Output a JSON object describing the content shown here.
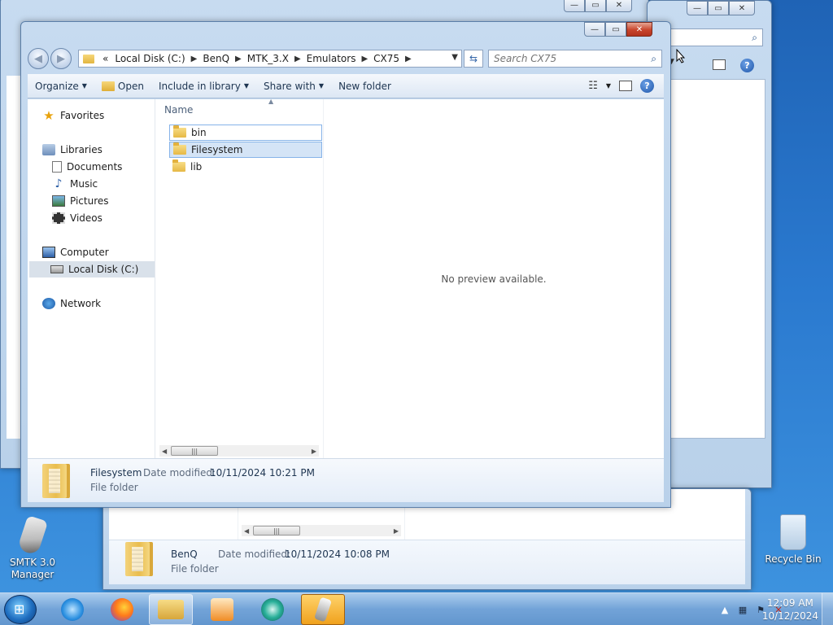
{
  "main_window": {
    "address_crumbs": [
      "Local Disk (C:)",
      "BenQ",
      "MTK_3.X",
      "Emulators",
      "CX75"
    ],
    "address_overflow": "«",
    "search_placeholder": "Search CX75",
    "toolbar": {
      "organize": "Organize",
      "open": "Open",
      "include_in_library": "Include in library",
      "share_with": "Share with",
      "new_folder": "New folder"
    },
    "nav_pane": {
      "favorites": "Favorites",
      "libraries": "Libraries",
      "documents": "Documents",
      "music": "Music",
      "pictures": "Pictures",
      "videos": "Videos",
      "computer": "Computer",
      "local_disk": "Local Disk (C:)",
      "network": "Network"
    },
    "column_header": "Name",
    "files": [
      {
        "name": "bin"
      },
      {
        "name": "Filesystem"
      },
      {
        "name": "lib"
      }
    ],
    "preview_text": "No preview available.",
    "details": {
      "name": "Filesystem",
      "date_label": "Date modified:",
      "date_value": "10/11/2024 10:21 PM",
      "type": "File folder"
    }
  },
  "background_window": {
    "details": {
      "name": "BenQ",
      "date_label": "Date modified:",
      "date_value": "10/11/2024 10:08 PM",
      "type": "File folder"
    }
  },
  "desktop": {
    "smtk_label_line1": "SMTK 3.0",
    "smtk_label_line2": "Manager",
    "recycle_label": "Recycle Bin"
  },
  "taskbar": {
    "time": "12:09 AM",
    "date": "10/12/2024"
  },
  "colors": {
    "desktop": "#2a79cf",
    "close_button": "#c8442b",
    "selection": "#d4e4f6"
  },
  "icons": {
    "favorites": "star-icon",
    "libraries": "libraries-icon",
    "documents": "documents-icon",
    "music": "music-icon",
    "pictures": "pictures-icon",
    "videos": "videos-icon",
    "computer": "computer-icon",
    "local_disk": "disk-icon",
    "network": "network-icon",
    "folder": "folder-icon"
  }
}
